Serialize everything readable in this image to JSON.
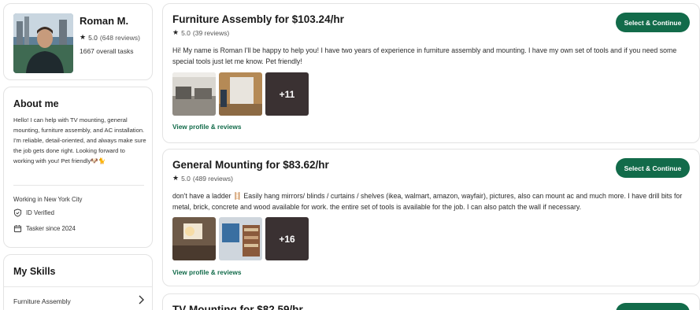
{
  "profile": {
    "name": "Roman M.",
    "rating": "5.0",
    "reviews": "(648 reviews)",
    "tasks": "1667 overall tasks"
  },
  "about": {
    "title": "About me",
    "text": "Hello! I can help with TV mounting, general mounting, furniture assembly, and AC installation. I'm reliable, detail-oriented, and always make sure the job gets done right. Looking forward to working with you! Pet friendly",
    "emojis": "🐶🐈",
    "location": "Working in New York City",
    "id_verified": "ID Verified",
    "since": "Tasker since 2024"
  },
  "skills": {
    "title": "My Skills",
    "items": [
      "Furniture Assembly"
    ]
  },
  "services": [
    {
      "title": "Furniture Assembly for $103.24/hr",
      "rating": "5.0",
      "reviews": "(39 reviews)",
      "button": "Select & Continue",
      "description": "Hi! My name is Roman I'll be happy to help you! I have two years of experience in furniture assembly and mounting. I have my own set of tools and if you need some special tools just let me know. Pet friendly!",
      "more_photos": "+11",
      "link": "View profile & reviews"
    },
    {
      "title": "General Mounting for $83.62/hr",
      "rating": "5.0",
      "reviews": "(489 reviews)",
      "button": "Select & Continue",
      "description": "don't have a ladder 🪜 Easily hang mirrors/ blinds / curtains / shelves (ikea, walmart, amazon, wayfair), pictures, also can mount ac and much more. I have drill bits for metal, brick, concrete and wood available for work. the entire set of tools is available for the job. I can also patch the wall if necessary.",
      "more_photos": "+16",
      "link": "View profile & reviews"
    },
    {
      "title": "TV Mounting for $82.59/hr",
      "button": "Select & Continue"
    }
  ],
  "colors": {
    "accent": "#126b4a",
    "border": "#e3e3e3"
  },
  "icons": {
    "star": "star-icon",
    "id": "shield-check-icon",
    "calendar": "calendar-icon",
    "chevron": "chevron-right-icon"
  }
}
